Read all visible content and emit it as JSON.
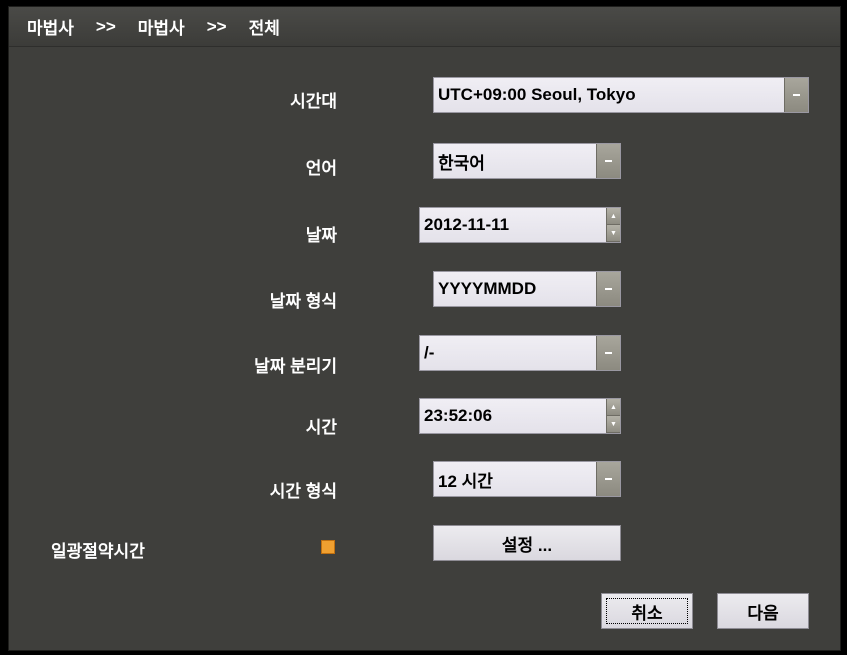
{
  "breadcrumb": {
    "items": [
      "마법사",
      "마법사",
      "전체"
    ],
    "separator": ">>"
  },
  "form": {
    "timezone": {
      "label": "시간대",
      "value": "UTC+09:00 Seoul, Tokyo"
    },
    "language": {
      "label": "언어",
      "value": "한국어"
    },
    "date": {
      "label": "날짜",
      "value": "2012-11-11"
    },
    "date_format": {
      "label": "날짜 형식",
      "value": "YYYYMMDD"
    },
    "date_separator": {
      "label": "날짜 분리기",
      "value": "/-"
    },
    "time": {
      "label": "시간",
      "value": "23:52:06"
    },
    "time_format": {
      "label": "시간 형식",
      "value": "12 시간"
    },
    "dst": {
      "label": "일광절약시간",
      "checked": true,
      "settings_label": "설정 ..."
    }
  },
  "footer": {
    "cancel_label": "취소",
    "next_label": "다음"
  },
  "colors": {
    "background": "#3f3f3c",
    "checkbox": "#f0a030",
    "field": "#e8e6ee"
  }
}
